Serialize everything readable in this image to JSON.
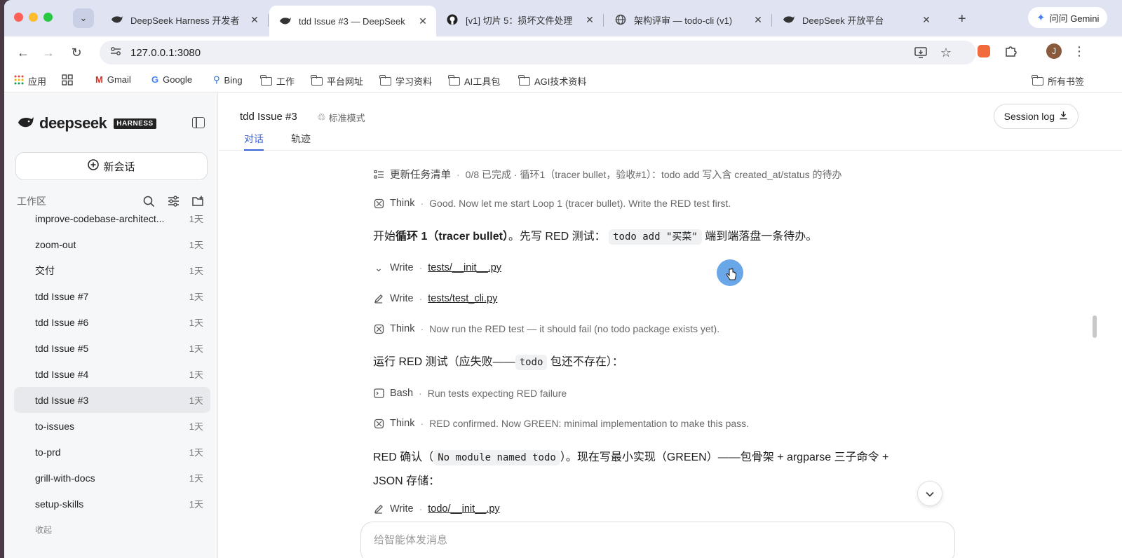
{
  "browser": {
    "tabs": [
      {
        "title": "DeepSeek Harness 开发者",
        "icon": "deepseek-icon"
      },
      {
        "title": "tdd Issue #3 — DeepSeek",
        "icon": "deepseek-icon"
      },
      {
        "title": "[v1] 切片 5：损坏文件处理",
        "icon": "github-icon"
      },
      {
        "title": "架构评审 — todo-cli (v1)",
        "icon": "globe-icon"
      },
      {
        "title": "DeepSeek 开放平台",
        "icon": "deepseek-icon"
      }
    ],
    "new_tab": "+",
    "gemini_label": "问问 Gemini",
    "url": "127.0.0.1:3080",
    "avatar_letter": "J",
    "bookmarks": [
      "应用",
      "Gmail",
      "Google",
      "Bing",
      "工作",
      "平台网址",
      "学习资料",
      "AI工具包",
      "AGI技术资料"
    ],
    "all_bookmarks": "所有书签"
  },
  "sidebar": {
    "logo_text": "deepseek",
    "badge": "HARNESS",
    "new_chat": "新会话",
    "workspace_label": "工作区",
    "items": [
      {
        "name": "improve-codebase-architect...",
        "age": "1天"
      },
      {
        "name": "zoom-out",
        "age": "1天"
      },
      {
        "name": "交付",
        "age": "1天"
      },
      {
        "name": "tdd Issue #7",
        "age": "1天"
      },
      {
        "name": "tdd Issue #6",
        "age": "1天"
      },
      {
        "name": "tdd Issue #5",
        "age": "1天"
      },
      {
        "name": "tdd Issue #4",
        "age": "1天"
      },
      {
        "name": "tdd Issue #3",
        "age": "1天"
      },
      {
        "name": "to-issues",
        "age": "1天"
      },
      {
        "name": "to-prd",
        "age": "1天"
      },
      {
        "name": "grill-with-docs",
        "age": "1天"
      },
      {
        "name": "setup-skills",
        "age": "1天"
      }
    ],
    "collapse": "收起"
  },
  "main": {
    "title": "tdd Issue #3",
    "mode": "标准模式",
    "tabs": [
      "对话",
      "轨迹"
    ],
    "session_log": "Session log",
    "input_placeholder": "给智能体发消息",
    "feed": {
      "r1": {
        "kind": "更新任务清单",
        "text": "0/8 已完成 · 循环1（tracer bullet，验收#1）：todo add 写入含 created_at/status 的待办"
      },
      "r2": {
        "kind": "Think",
        "text": "Good. Now let me start Loop 1 (tracer bullet). Write the RED test first."
      },
      "m1": {
        "pre": "开始",
        "bold": "循环 1（tracer bullet）",
        "mid": "。先写 RED 测试：",
        "code": "todo add \"买菜\"",
        "post": "端到端落盘一条待办。"
      },
      "r3": {
        "kind": "Write",
        "file": "tests/__init__.py"
      },
      "r4": {
        "kind": "Write",
        "file": "tests/test_cli.py"
      },
      "r5": {
        "kind": "Think",
        "text": "Now run the RED test — it should fail (no todo package exists yet)."
      },
      "m2": {
        "pre": "运行 RED 测试（应失败——",
        "code": "todo",
        "post": "包还不存在）："
      },
      "r6": {
        "kind": "Bash",
        "text": "Run tests expecting RED failure"
      },
      "r7": {
        "kind": "Think",
        "text": "RED confirmed. Now GREEN: minimal implementation to make this pass."
      },
      "m3": {
        "pre": "RED 确认（",
        "code": "No module named todo",
        "post": "）。现在写最小实现（GREEN）——包骨架 + argparse 三子命令 +",
        "line2": "JSON 存储："
      },
      "r8": {
        "kind": "Write",
        "file": "todo/__init__.py"
      }
    }
  }
}
